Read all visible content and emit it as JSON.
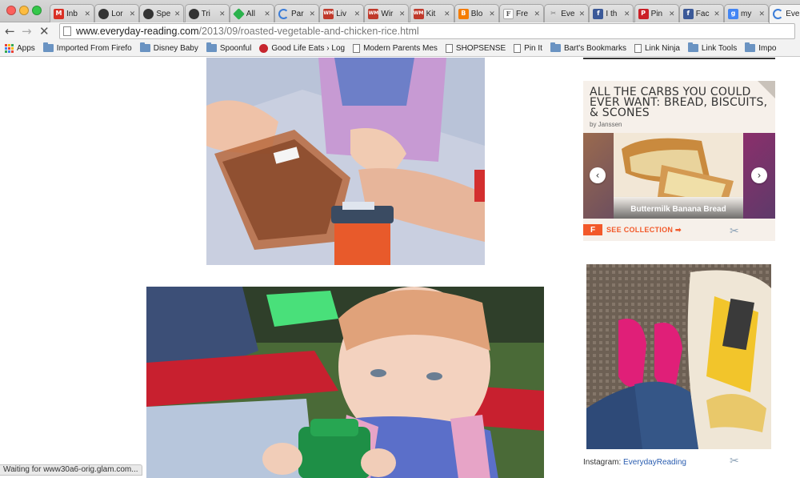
{
  "browser": {
    "tabs": [
      {
        "title": "Inb",
        "icon": "gmail-icon",
        "color": "#d93025",
        "glyph": "M"
      },
      {
        "title": "Lor",
        "icon": "site-icon",
        "color": "#333333",
        "glyph": ""
      },
      {
        "title": "Spe",
        "icon": "site-icon",
        "color": "#333333",
        "glyph": ""
      },
      {
        "title": "Tri",
        "icon": "site-icon",
        "color": "#333333",
        "glyph": ""
      },
      {
        "title": "All",
        "icon": "feedly-icon",
        "color": "#2bb24c",
        "glyph": ""
      },
      {
        "title": "Par",
        "icon": "loading-icon",
        "color": "#3b7dd8",
        "glyph": ""
      },
      {
        "title": "Liv",
        "icon": "wm-icon",
        "color": "#c0392b",
        "glyph": "WM"
      },
      {
        "title": "Wir",
        "icon": "wm-icon",
        "color": "#c0392b",
        "glyph": "WM"
      },
      {
        "title": "Kit",
        "icon": "wm-icon",
        "color": "#c0392b",
        "glyph": "WM"
      },
      {
        "title": "Blo",
        "icon": "blogger-icon",
        "color": "#f57d00",
        "glyph": "B"
      },
      {
        "title": "Fre",
        "icon": "f-icon",
        "color": "#ffffff",
        "glyph": "F"
      },
      {
        "title": "Eve",
        "icon": "tools-icon",
        "color": "#888888",
        "glyph": "✂"
      },
      {
        "title": "I th",
        "icon": "facebook-icon",
        "color": "#3b5998",
        "glyph": "f"
      },
      {
        "title": "Pin",
        "icon": "pinterest-icon",
        "color": "#cb2027",
        "glyph": "P"
      },
      {
        "title": "Fac",
        "icon": "facebook-icon",
        "color": "#3b5998",
        "glyph": "f"
      },
      {
        "title": "my",
        "icon": "google-icon",
        "color": "#4285f4",
        "glyph": "g"
      },
      {
        "title": "Eve",
        "icon": "loading-icon",
        "color": "#3b7dd8",
        "glyph": "",
        "active": true
      }
    ],
    "url_domain": "www.everyday-reading.com",
    "url_path": "/2013/09/roasted-vegetable-and-chicken-rice.html",
    "bookmarks": [
      {
        "label": "Apps",
        "icon": "apps-icon"
      },
      {
        "label": "Imported From Firefo",
        "icon": "folder-icon"
      },
      {
        "label": "Disney Baby",
        "icon": "folder-icon"
      },
      {
        "label": "Spoonful",
        "icon": "folder-icon"
      },
      {
        "label": "Good Life Eats › Log",
        "icon": "dot-icon"
      },
      {
        "label": "Modern Parents Mes",
        "icon": "page-icon"
      },
      {
        "label": "SHOPSENSE",
        "icon": "page-icon"
      },
      {
        "label": "Pin It",
        "icon": "page-icon"
      },
      {
        "label": "Bart's Bookmarks",
        "icon": "folder-icon"
      },
      {
        "label": "Link Ninja",
        "icon": "page-icon"
      },
      {
        "label": "Link Tools",
        "icon": "folder-icon"
      },
      {
        "label": "Impo",
        "icon": "folder-icon"
      }
    ]
  },
  "widget": {
    "title": "ALL THE CARBS YOU COULD EVER WANT: BREAD, BISCUITS, & SCONES",
    "byline": "by Janssen",
    "slide_caption": "Buttermilk Banana Bread",
    "prev_glyph": "‹",
    "next_glyph": "›",
    "see_collection": "SEE COLLECTION ➡",
    "logo": "F"
  },
  "instagram": {
    "label": "Instagram:",
    "handle": "EverydayReading"
  },
  "status": "Waiting for www30a6-orig.glam.com...",
  "colors": {
    "accent_orange": "#f2592a",
    "link_blue": "#2a5db0"
  }
}
